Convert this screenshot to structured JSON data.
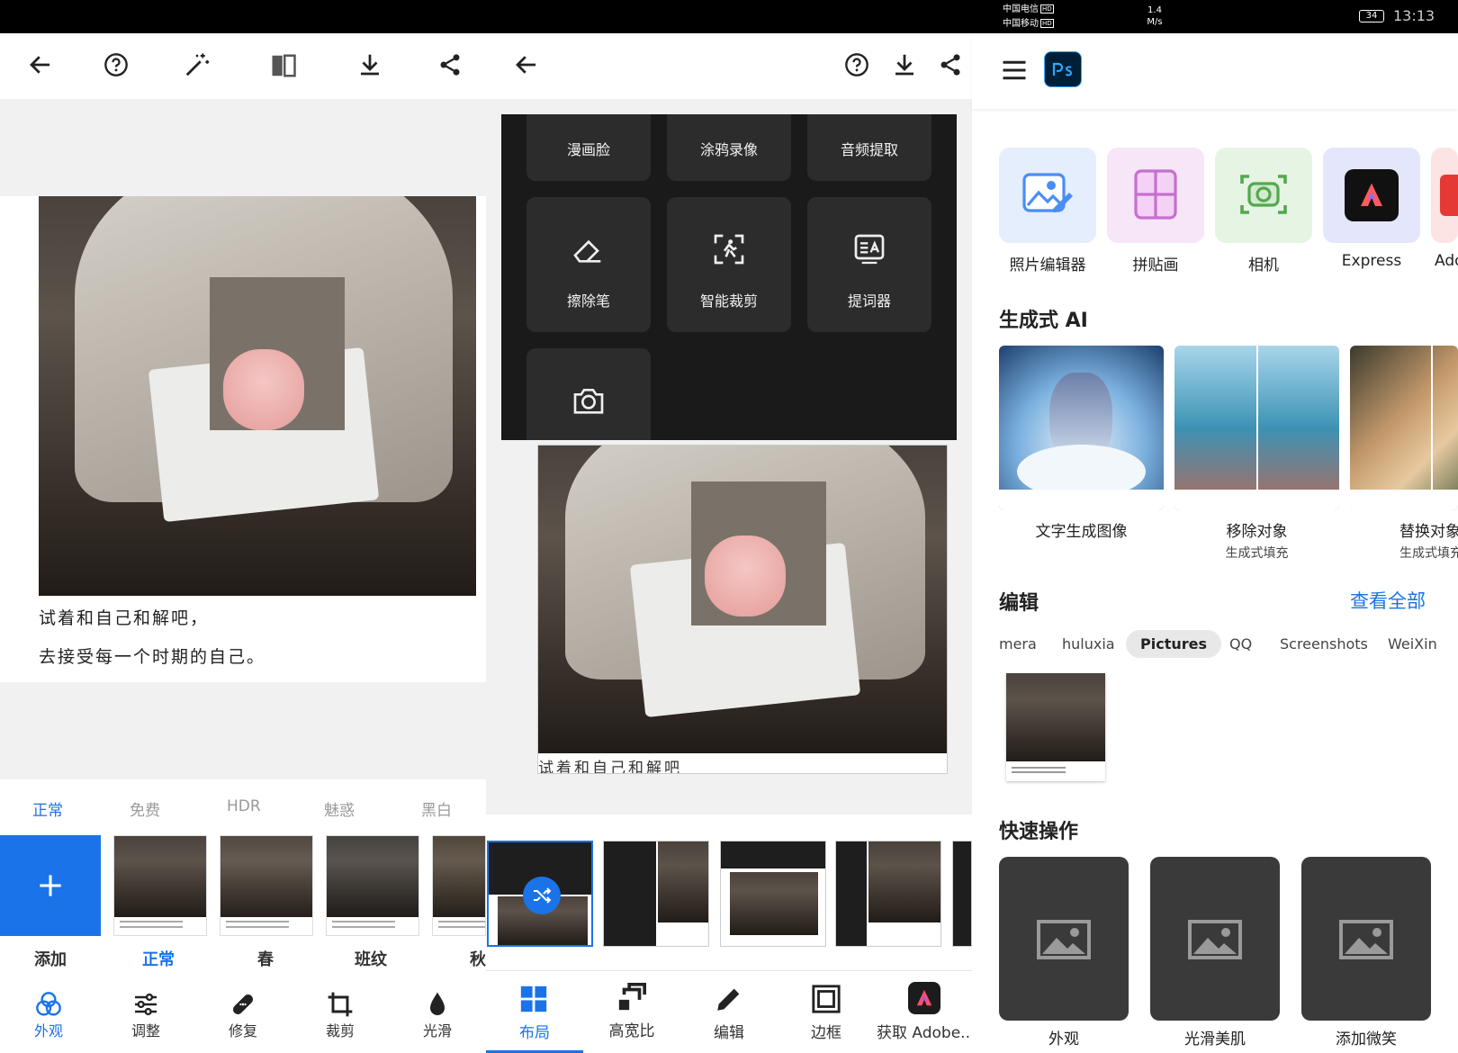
{
  "status_bar": {
    "carrier1": "中国电信",
    "carrier2": "中国移动",
    "hd": "HD",
    "speed_value": "1.4",
    "speed_unit": "M/s",
    "battery": "34",
    "time": "13:13"
  },
  "panel1": {
    "caption_line1": "试着和自己和解吧，",
    "caption_line2": "去接受每一个时期的自己。",
    "filter_tabs": [
      "正常",
      "免费",
      "HDR",
      "魅惑",
      "黑白"
    ],
    "thumb_labels": [
      "添加",
      "正常",
      "春",
      "班纹",
      "秋"
    ],
    "bottom_nav": [
      "外观",
      "调整",
      "修复",
      "裁剪",
      "光滑"
    ],
    "accent_color": "#1a73e8"
  },
  "panel2": {
    "tools": [
      "漫画脸",
      "涂鸦录像",
      "音频提取",
      "擦除笔",
      "智能裁剪",
      "提词器"
    ],
    "photo_caption_partial": "试着和自己和解吧",
    "bottom_nav": [
      "布局",
      "高宽比",
      "编辑",
      "边框",
      "获取 Adobe.."
    ]
  },
  "panel3": {
    "apps": [
      "照片编辑器",
      "拼贴画",
      "相机",
      "Express",
      "Ado"
    ],
    "gen_ai_title": "生成式 AI",
    "ai_cards": [
      {
        "title": "文字生成图像",
        "sub": ""
      },
      {
        "title": "移除对象",
        "sub": "生成式填充"
      },
      {
        "title": "替换对象",
        "sub": "生成式填充"
      }
    ],
    "edit_title": "编辑",
    "view_all": "查看全部",
    "folders": [
      "mera",
      "huluxia",
      "Pictures",
      "QQ",
      "Screenshots",
      "WeiXin"
    ],
    "quick_title": "快速操作",
    "quick_actions": [
      "外观",
      "光滑美肌",
      "添加微笑"
    ],
    "link_color": "#1a73e8"
  }
}
